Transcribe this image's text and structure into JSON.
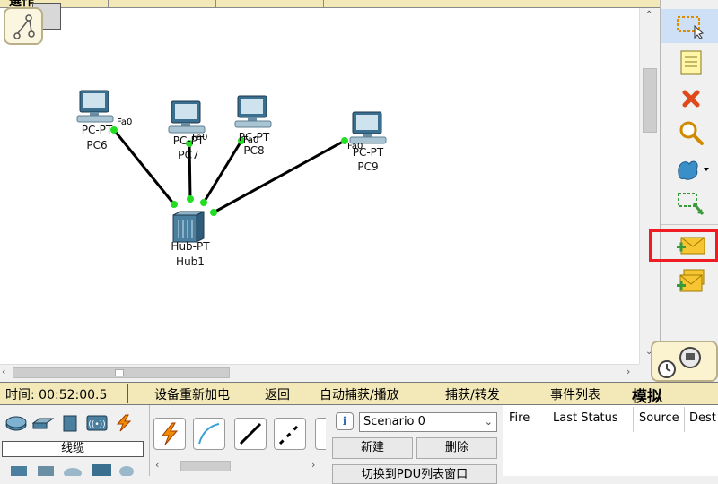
{
  "top": {
    "cut_text": "選作"
  },
  "workspace": {
    "devices": [
      {
        "id": "pc6",
        "model": "PC-PT",
        "name": "PC6"
      },
      {
        "id": "pc7",
        "model": "PC-PT",
        "name": "PC7"
      },
      {
        "id": "pc8",
        "model": "PC-PT",
        "name": "PC8"
      },
      {
        "id": "pc9",
        "model": "PC-PT",
        "name": "PC9"
      },
      {
        "id": "hub1",
        "model": "Hub-PT",
        "name": "Hub1"
      }
    ],
    "port_label": "Fa0"
  },
  "right_toolbar": {
    "tools": [
      "select-icon",
      "note-icon",
      "delete-icon",
      "inspect-icon",
      "draw-shape-icon",
      "resize-icon",
      "add-simple-pdu-icon",
      "add-complex-pdu-icon"
    ],
    "highlight_color": "#ee1d23"
  },
  "status_bar": {
    "time": "时间: 00:52:00.5",
    "power_cycle": "设备重新加电",
    "back": "返回",
    "auto_capture": "自动捕获/播放",
    "capture_forward": "捕获/转发",
    "event_list": "事件列表",
    "mode": "模拟"
  },
  "bottom": {
    "category_label": "线缆",
    "scenario_value": "Scenario 0",
    "new_button": "新建",
    "delete_button": "删除",
    "toggle_button": "切换到PDU列表窗口",
    "pdu_columns": [
      "Fire",
      "Last Status",
      "Source",
      "Dest"
    ]
  },
  "colors": {
    "status_bar_bg": "#f3e9b8",
    "link_light": "#22dd22",
    "cable": "#000000"
  }
}
